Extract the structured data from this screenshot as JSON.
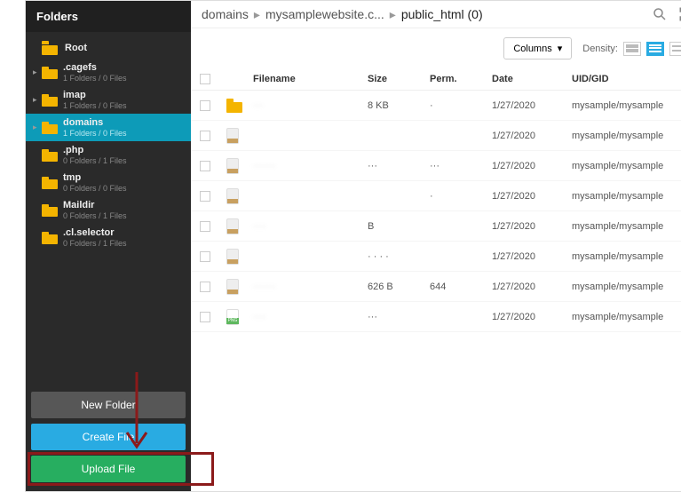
{
  "sidebar": {
    "title": "Folders",
    "items": [
      {
        "label": "Root",
        "sub": "",
        "chev": ""
      },
      {
        "label": ".cagefs",
        "sub": "1 Folders / 0 Files",
        "chev": "▸"
      },
      {
        "label": "imap",
        "sub": "1 Folders / 0 Files",
        "chev": "▸"
      },
      {
        "label": "domains",
        "sub": "1 Folders / 0 Files",
        "chev": "▸"
      },
      {
        "label": ".php",
        "sub": "0 Folders / 1 Files",
        "chev": ""
      },
      {
        "label": "tmp",
        "sub": "0 Folders / 0 Files",
        "chev": ""
      },
      {
        "label": "Maildir",
        "sub": "0 Folders / 1 Files",
        "chev": ""
      },
      {
        "label": ".cl.selector",
        "sub": "0 Folders / 1 Files",
        "chev": ""
      }
    ],
    "buttons": {
      "newfolder": "New Folder",
      "createfile": "Create File",
      "uploadfile": "Upload File"
    }
  },
  "breadcrumb": {
    "items": [
      "domains",
      "mysamplewebsite.c...",
      "public_html  (0)"
    ]
  },
  "controls": {
    "columns": "Columns",
    "density": "Density:"
  },
  "table": {
    "headers": {
      "filename": "Filename",
      "size": "Size",
      "perm": "Perm.",
      "date": "Date",
      "uidgid": "UID/GID"
    },
    "rows": [
      {
        "icon": "folder",
        "name": "···",
        "size": "8 KB",
        "perm": "·",
        "date": "1/27/2020",
        "uid": "mysample/mysample"
      },
      {
        "icon": "doc",
        "name": "",
        "size": "",
        "perm": "",
        "date": "1/27/2020",
        "uid": "mysample/mysample"
      },
      {
        "icon": "doc",
        "name": "·······",
        "size": "···",
        "perm": "···",
        "date": "1/27/2020",
        "uid": "mysample/mysample"
      },
      {
        "icon": "doc",
        "name": "",
        "size": "",
        "perm": "·",
        "date": "1/27/2020",
        "uid": "mysample/mysample"
      },
      {
        "icon": "doc",
        "name": "····",
        "size": "  B",
        "perm": "",
        "date": "1/27/2020",
        "uid": "mysample/mysample"
      },
      {
        "icon": "doc",
        "name": "",
        "size": "· · · ·",
        "perm": "",
        "date": "1/27/2020",
        "uid": "mysample/mysample"
      },
      {
        "icon": "doc",
        "name": "·······",
        "size": "626 B",
        "perm": "644",
        "date": "1/27/2020",
        "uid": "mysample/mysample"
      },
      {
        "icon": "img",
        "name": "····",
        "size": "···",
        "perm": "",
        "date": "1/27/2020",
        "uid": "mysample/mysample"
      }
    ]
  }
}
